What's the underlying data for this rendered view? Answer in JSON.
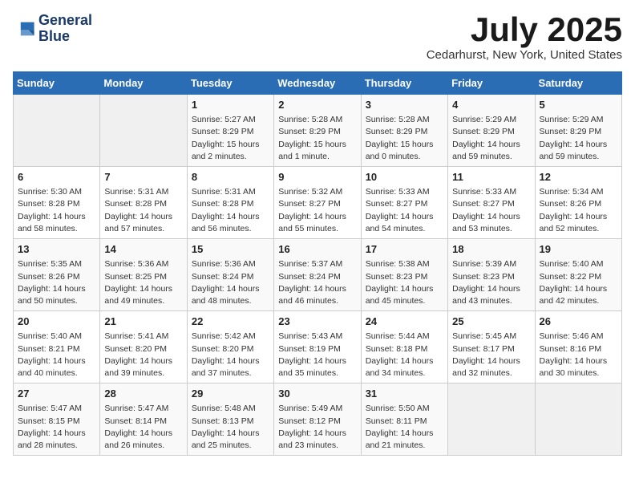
{
  "header": {
    "logo_line1": "General",
    "logo_line2": "Blue",
    "month_year": "July 2025",
    "location": "Cedarhurst, New York, United States"
  },
  "days_of_week": [
    "Sunday",
    "Monday",
    "Tuesday",
    "Wednesday",
    "Thursday",
    "Friday",
    "Saturday"
  ],
  "weeks": [
    [
      {
        "day": "",
        "sunrise": "",
        "sunset": "",
        "daylight": ""
      },
      {
        "day": "",
        "sunrise": "",
        "sunset": "",
        "daylight": ""
      },
      {
        "day": "1",
        "sunrise": "Sunrise: 5:27 AM",
        "sunset": "Sunset: 8:29 PM",
        "daylight": "Daylight: 15 hours and 2 minutes."
      },
      {
        "day": "2",
        "sunrise": "Sunrise: 5:28 AM",
        "sunset": "Sunset: 8:29 PM",
        "daylight": "Daylight: 15 hours and 1 minute."
      },
      {
        "day": "3",
        "sunrise": "Sunrise: 5:28 AM",
        "sunset": "Sunset: 8:29 PM",
        "daylight": "Daylight: 15 hours and 0 minutes."
      },
      {
        "day": "4",
        "sunrise": "Sunrise: 5:29 AM",
        "sunset": "Sunset: 8:29 PM",
        "daylight": "Daylight: 14 hours and 59 minutes."
      },
      {
        "day": "5",
        "sunrise": "Sunrise: 5:29 AM",
        "sunset": "Sunset: 8:29 PM",
        "daylight": "Daylight: 14 hours and 59 minutes."
      }
    ],
    [
      {
        "day": "6",
        "sunrise": "Sunrise: 5:30 AM",
        "sunset": "Sunset: 8:28 PM",
        "daylight": "Daylight: 14 hours and 58 minutes."
      },
      {
        "day": "7",
        "sunrise": "Sunrise: 5:31 AM",
        "sunset": "Sunset: 8:28 PM",
        "daylight": "Daylight: 14 hours and 57 minutes."
      },
      {
        "day": "8",
        "sunrise": "Sunrise: 5:31 AM",
        "sunset": "Sunset: 8:28 PM",
        "daylight": "Daylight: 14 hours and 56 minutes."
      },
      {
        "day": "9",
        "sunrise": "Sunrise: 5:32 AM",
        "sunset": "Sunset: 8:27 PM",
        "daylight": "Daylight: 14 hours and 55 minutes."
      },
      {
        "day": "10",
        "sunrise": "Sunrise: 5:33 AM",
        "sunset": "Sunset: 8:27 PM",
        "daylight": "Daylight: 14 hours and 54 minutes."
      },
      {
        "day": "11",
        "sunrise": "Sunrise: 5:33 AM",
        "sunset": "Sunset: 8:27 PM",
        "daylight": "Daylight: 14 hours and 53 minutes."
      },
      {
        "day": "12",
        "sunrise": "Sunrise: 5:34 AM",
        "sunset": "Sunset: 8:26 PM",
        "daylight": "Daylight: 14 hours and 52 minutes."
      }
    ],
    [
      {
        "day": "13",
        "sunrise": "Sunrise: 5:35 AM",
        "sunset": "Sunset: 8:26 PM",
        "daylight": "Daylight: 14 hours and 50 minutes."
      },
      {
        "day": "14",
        "sunrise": "Sunrise: 5:36 AM",
        "sunset": "Sunset: 8:25 PM",
        "daylight": "Daylight: 14 hours and 49 minutes."
      },
      {
        "day": "15",
        "sunrise": "Sunrise: 5:36 AM",
        "sunset": "Sunset: 8:24 PM",
        "daylight": "Daylight: 14 hours and 48 minutes."
      },
      {
        "day": "16",
        "sunrise": "Sunrise: 5:37 AM",
        "sunset": "Sunset: 8:24 PM",
        "daylight": "Daylight: 14 hours and 46 minutes."
      },
      {
        "day": "17",
        "sunrise": "Sunrise: 5:38 AM",
        "sunset": "Sunset: 8:23 PM",
        "daylight": "Daylight: 14 hours and 45 minutes."
      },
      {
        "day": "18",
        "sunrise": "Sunrise: 5:39 AM",
        "sunset": "Sunset: 8:23 PM",
        "daylight": "Daylight: 14 hours and 43 minutes."
      },
      {
        "day": "19",
        "sunrise": "Sunrise: 5:40 AM",
        "sunset": "Sunset: 8:22 PM",
        "daylight": "Daylight: 14 hours and 42 minutes."
      }
    ],
    [
      {
        "day": "20",
        "sunrise": "Sunrise: 5:40 AM",
        "sunset": "Sunset: 8:21 PM",
        "daylight": "Daylight: 14 hours and 40 minutes."
      },
      {
        "day": "21",
        "sunrise": "Sunrise: 5:41 AM",
        "sunset": "Sunset: 8:20 PM",
        "daylight": "Daylight: 14 hours and 39 minutes."
      },
      {
        "day": "22",
        "sunrise": "Sunrise: 5:42 AM",
        "sunset": "Sunset: 8:20 PM",
        "daylight": "Daylight: 14 hours and 37 minutes."
      },
      {
        "day": "23",
        "sunrise": "Sunrise: 5:43 AM",
        "sunset": "Sunset: 8:19 PM",
        "daylight": "Daylight: 14 hours and 35 minutes."
      },
      {
        "day": "24",
        "sunrise": "Sunrise: 5:44 AM",
        "sunset": "Sunset: 8:18 PM",
        "daylight": "Daylight: 14 hours and 34 minutes."
      },
      {
        "day": "25",
        "sunrise": "Sunrise: 5:45 AM",
        "sunset": "Sunset: 8:17 PM",
        "daylight": "Daylight: 14 hours and 32 minutes."
      },
      {
        "day": "26",
        "sunrise": "Sunrise: 5:46 AM",
        "sunset": "Sunset: 8:16 PM",
        "daylight": "Daylight: 14 hours and 30 minutes."
      }
    ],
    [
      {
        "day": "27",
        "sunrise": "Sunrise: 5:47 AM",
        "sunset": "Sunset: 8:15 PM",
        "daylight": "Daylight: 14 hours and 28 minutes."
      },
      {
        "day": "28",
        "sunrise": "Sunrise: 5:47 AM",
        "sunset": "Sunset: 8:14 PM",
        "daylight": "Daylight: 14 hours and 26 minutes."
      },
      {
        "day": "29",
        "sunrise": "Sunrise: 5:48 AM",
        "sunset": "Sunset: 8:13 PM",
        "daylight": "Daylight: 14 hours and 25 minutes."
      },
      {
        "day": "30",
        "sunrise": "Sunrise: 5:49 AM",
        "sunset": "Sunset: 8:12 PM",
        "daylight": "Daylight: 14 hours and 23 minutes."
      },
      {
        "day": "31",
        "sunrise": "Sunrise: 5:50 AM",
        "sunset": "Sunset: 8:11 PM",
        "daylight": "Daylight: 14 hours and 21 minutes."
      },
      {
        "day": "",
        "sunrise": "",
        "sunset": "",
        "daylight": ""
      },
      {
        "day": "",
        "sunrise": "",
        "sunset": "",
        "daylight": ""
      }
    ]
  ]
}
